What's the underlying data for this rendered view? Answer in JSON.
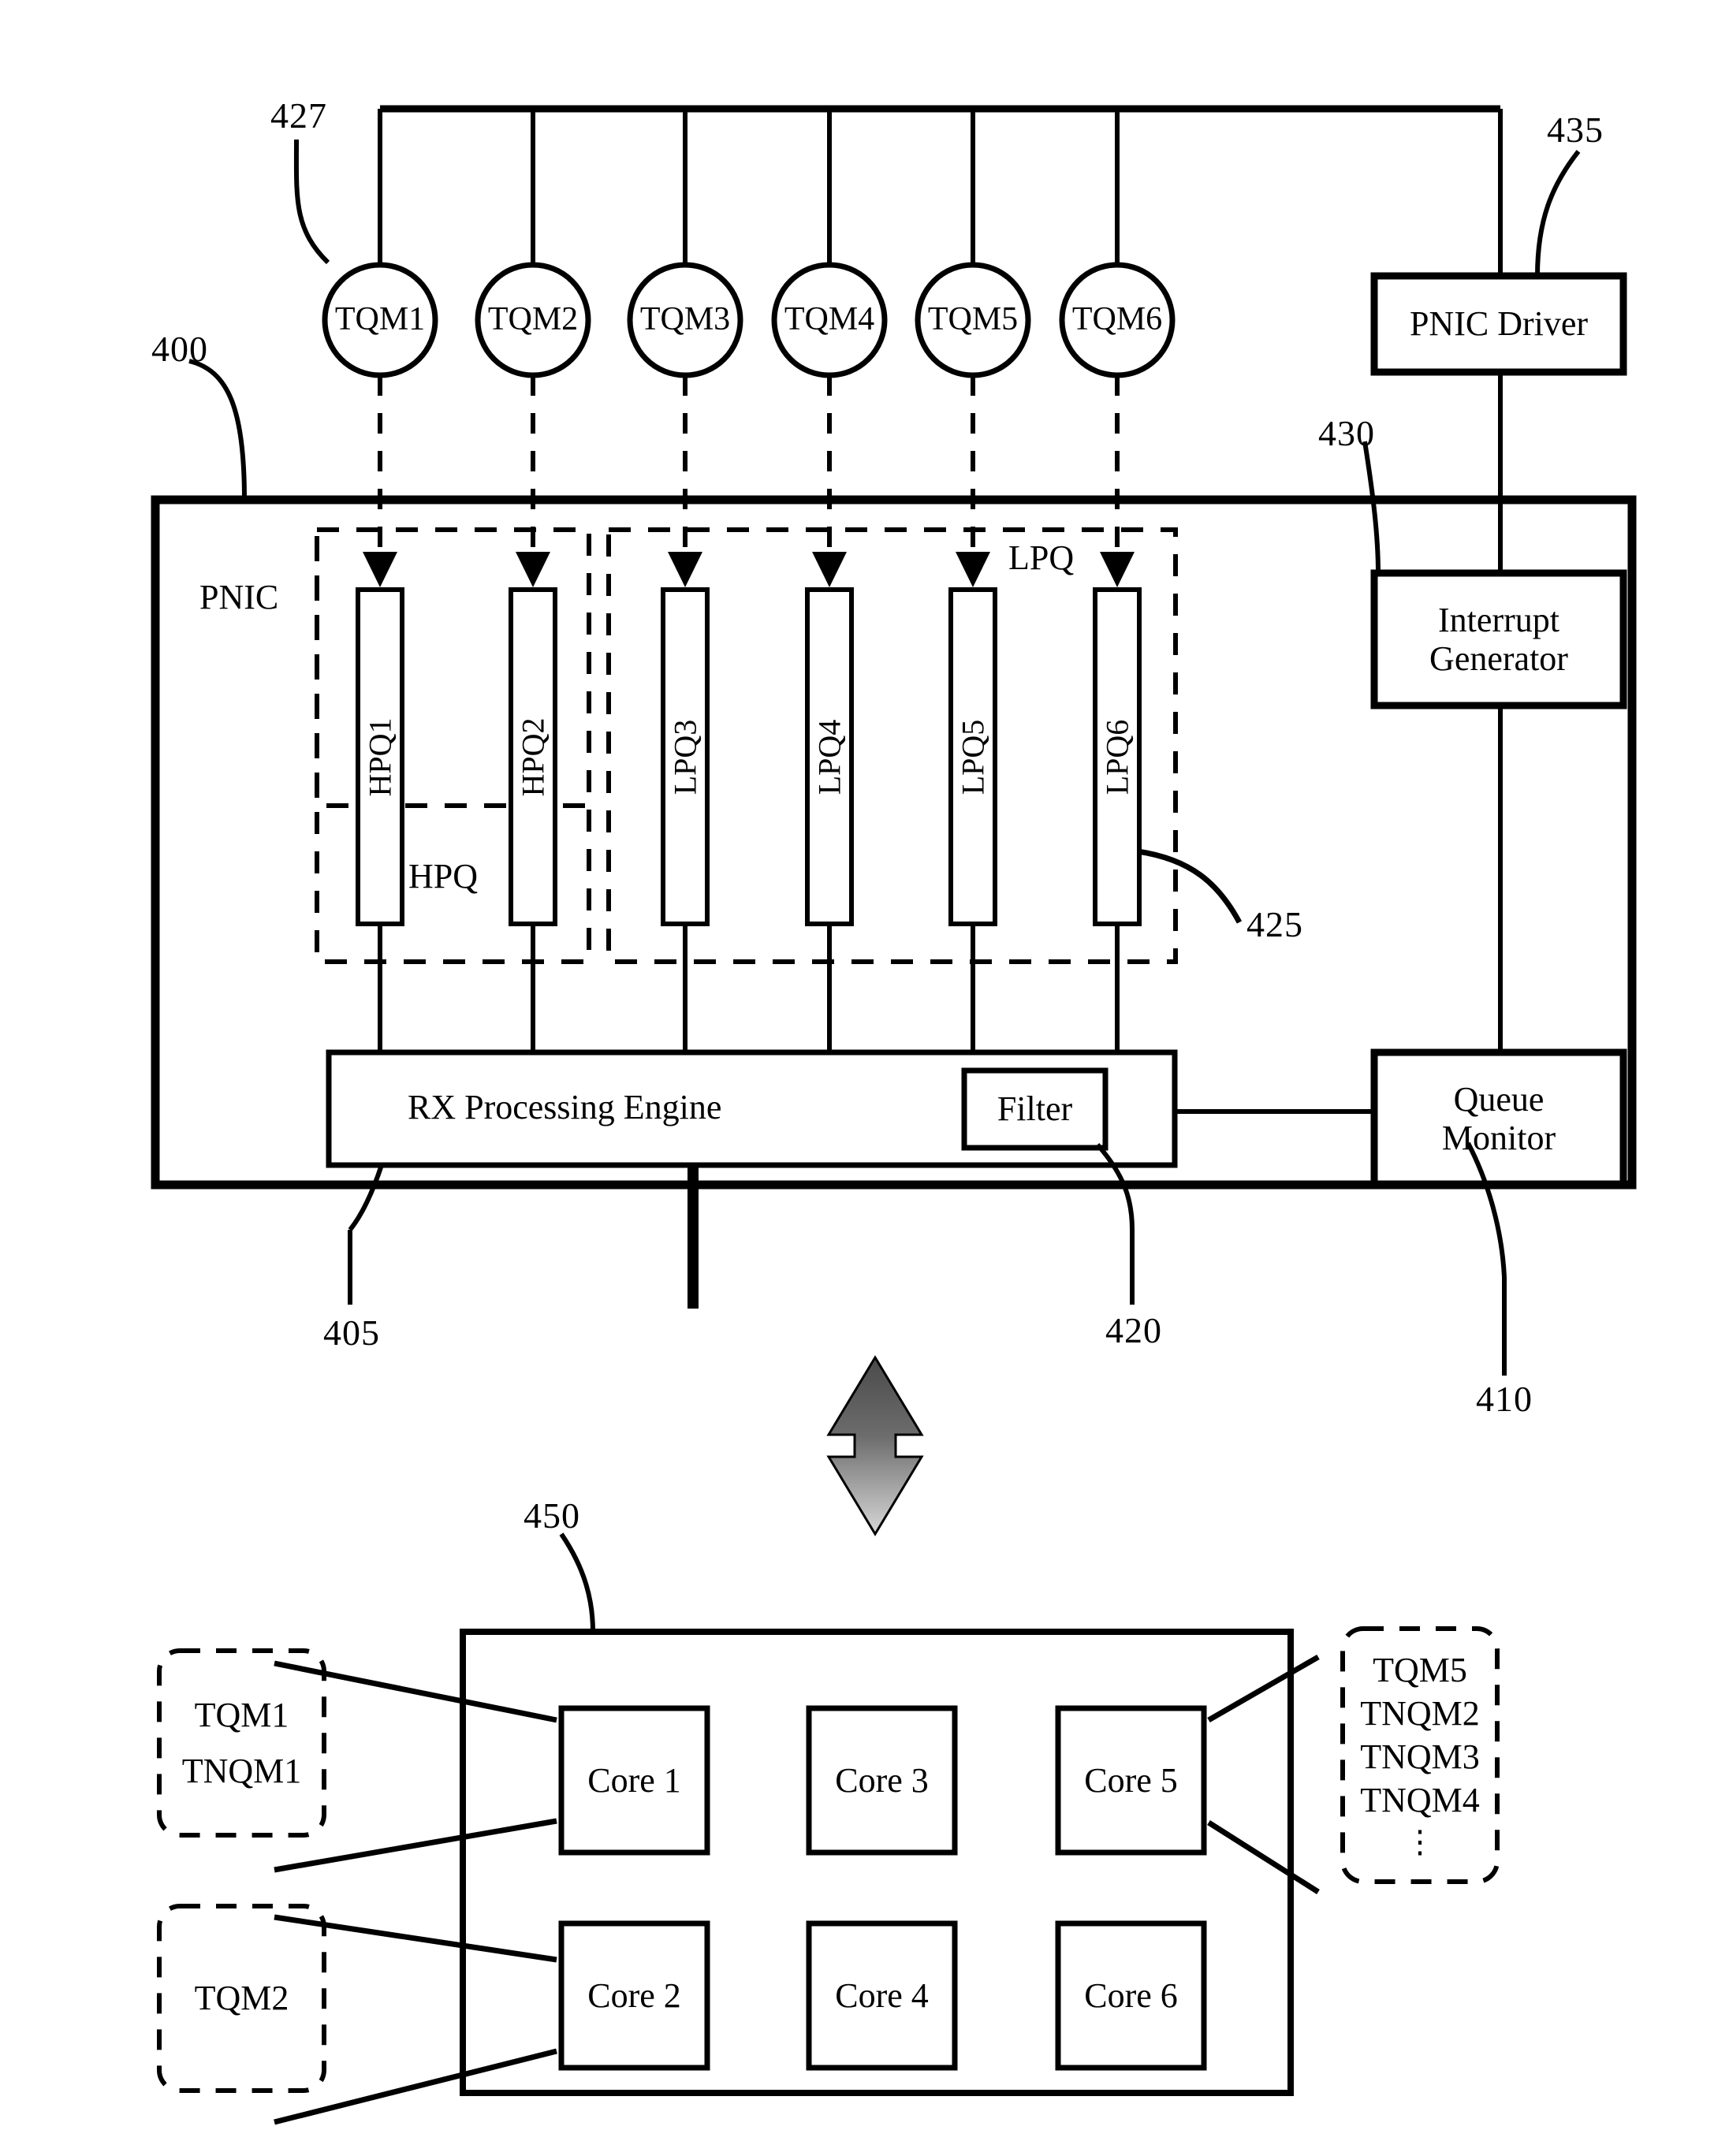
{
  "figure": {
    "title": "PNIC receive-queue architecture figure",
    "ref_numbers": {
      "r400": "400",
      "r405": "405",
      "r410": "410",
      "r420": "420",
      "r425": "425",
      "r427": "427",
      "r430": "430",
      "r435": "435",
      "r450": "450"
    }
  },
  "top": {
    "tqm_circles": [
      {
        "label": "TQM1"
      },
      {
        "label": "TQM2"
      },
      {
        "label": "TQM3"
      },
      {
        "label": "TQM4"
      },
      {
        "label": "TQM5"
      },
      {
        "label": "TQM6"
      }
    ],
    "pnic_driver": "PNIC Driver"
  },
  "pnic": {
    "label": "PNIC",
    "hpq_group_label": "HPQ",
    "lpq_group_label": "LPQ",
    "queues": [
      {
        "label": "HPQ1",
        "group": "HPQ"
      },
      {
        "label": "HPQ2",
        "group": "HPQ"
      },
      {
        "label": "LPQ3",
        "group": "LPQ"
      },
      {
        "label": "LPQ4",
        "group": "LPQ"
      },
      {
        "label": "LPQ5",
        "group": "LPQ"
      },
      {
        "label": "LPQ6",
        "group": "LPQ"
      }
    ],
    "rx_engine": "RX Processing Engine",
    "filter": "Filter",
    "interrupt_generator": "Interrupt\nGenerator",
    "interrupt_generator_line1": "Interrupt",
    "interrupt_generator_line2": "Generator",
    "queue_monitor_line1": "Queue",
    "queue_monitor_line2": "Monitor"
  },
  "host": {
    "cores": [
      {
        "label": "Core 1"
      },
      {
        "label": "Core 2"
      },
      {
        "label": "Core 3"
      },
      {
        "label": "Core 4"
      },
      {
        "label": "Core 5"
      },
      {
        "label": "Core 6"
      }
    ],
    "annotation_left_top": [
      "TQM1",
      "TNQM1"
    ],
    "annotation_left_bottom": [
      "TQM2"
    ],
    "annotation_right": [
      "TQM5",
      "TNQM2",
      "TNQM3",
      "TNQM4",
      "⋮"
    ]
  },
  "colors": {
    "stroke": "#000000",
    "background": "#ffffff",
    "arrow_fill_dark": "#4a4a4a",
    "arrow_fill_light": "#d8d8d8"
  }
}
